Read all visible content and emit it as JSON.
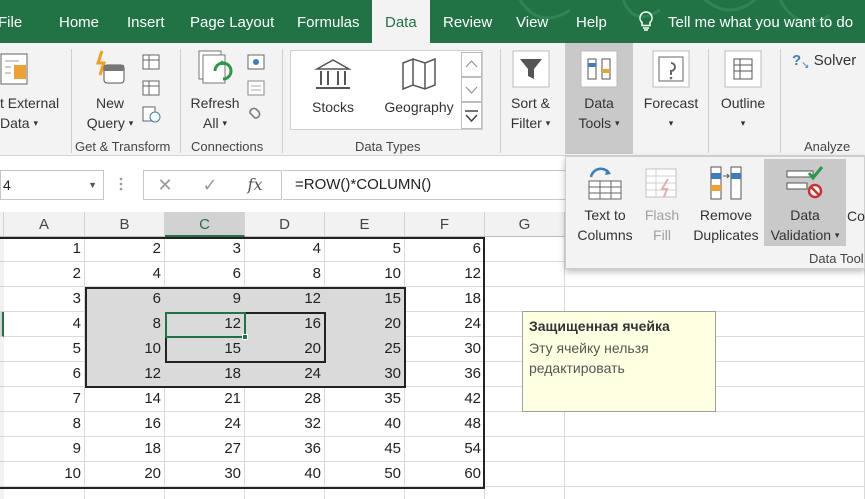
{
  "tabs": [
    {
      "label": "File",
      "active": false
    },
    {
      "label": "Home",
      "active": false
    },
    {
      "label": "Insert",
      "active": false
    },
    {
      "label": "Page Layout",
      "active": false
    },
    {
      "label": "Formulas",
      "active": false
    },
    {
      "label": "Data",
      "active": true
    },
    {
      "label": "Review",
      "active": false
    },
    {
      "label": "View",
      "active": false
    },
    {
      "label": "Help",
      "active": false
    }
  ],
  "tell_me": "Tell me what you want to do",
  "ribbon": {
    "get_external_data": {
      "line1": "t External",
      "line2": "Data"
    },
    "new_query": {
      "line1": "New",
      "line2": "Query"
    },
    "refresh_all": {
      "line1": "Refresh",
      "line2": "All"
    },
    "stocks": "Stocks",
    "geography": "Geography",
    "sort_filter": {
      "line1": "Sort &",
      "line2": "Filter"
    },
    "data_tools": {
      "line1": "Data",
      "line2": "Tools"
    },
    "forecast": "Forecast",
    "outline": "Outline",
    "solver": "Solver",
    "groups": {
      "get_transform": "Get & Transform",
      "connections": "Connections",
      "data_types": "Data Types",
      "analyze": "Analyze"
    }
  },
  "data_tools_panel": {
    "text_to_columns": {
      "line1": "Text to",
      "line2": "Columns"
    },
    "flash_fill": {
      "line1": "Flash",
      "line2": "Fill"
    },
    "remove_duplicates": {
      "line1": "Remove",
      "line2": "Duplicates"
    },
    "data_validation": {
      "line1": "Data",
      "line2": "Validation"
    },
    "more_cut": "Co",
    "group_label": "Data Tool"
  },
  "formula_bar": {
    "name_box": "4",
    "cancel": "✕",
    "enter": "✓",
    "fx": "fx",
    "formula": "=ROW()*COLUMN()"
  },
  "grid": {
    "columns": [
      "A",
      "B",
      "C",
      "D",
      "E",
      "F",
      "G"
    ],
    "selected_column": "C",
    "rows": [
      [
        "1",
        "2",
        "3",
        "4",
        "5",
        "6"
      ],
      [
        "2",
        "4",
        "6",
        "8",
        "10",
        "12"
      ],
      [
        "3",
        "6",
        "9",
        "12",
        "15",
        "18"
      ],
      [
        "4",
        "8",
        "12",
        "16",
        "20",
        "24"
      ],
      [
        "5",
        "10",
        "15",
        "20",
        "25",
        "30"
      ],
      [
        "6",
        "12",
        "18",
        "24",
        "30",
        "36"
      ],
      [
        "7",
        "14",
        "21",
        "28",
        "35",
        "42"
      ],
      [
        "8",
        "16",
        "24",
        "32",
        "40",
        "48"
      ],
      [
        "9",
        "18",
        "27",
        "36",
        "45",
        "54"
      ],
      [
        "10",
        "20",
        "30",
        "40",
        "50",
        "60"
      ]
    ]
  },
  "tooltip": {
    "title": "Защищенная ячейка",
    "body": "Эту ячейку нельзя редактировать"
  },
  "colors": {
    "excel_green": "#217346",
    "highlight_gray": "#dadada",
    "tooltip_bg": "#ffffe1"
  }
}
